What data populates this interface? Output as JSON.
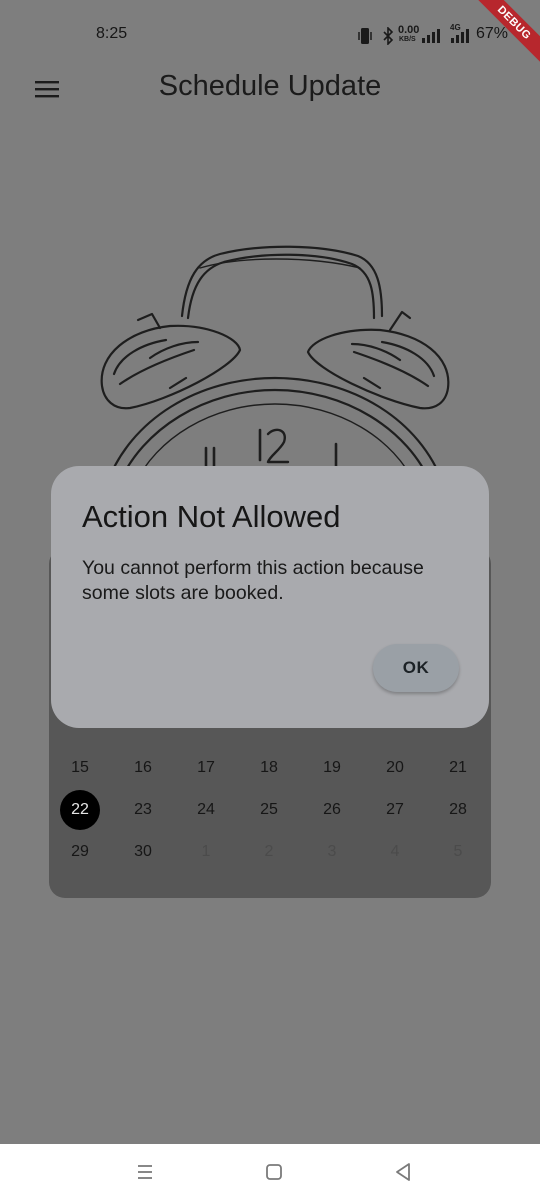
{
  "status_bar": {
    "time": "8:25",
    "net_speed": "0.00",
    "net_unit": "KB/S",
    "network_type": "4G",
    "battery": "67%",
    "icons": [
      "vibrate-icon",
      "bluetooth-icon",
      "signal-icon",
      "signal-icon"
    ],
    "debug_banner": "DEBUG"
  },
  "app_bar": {
    "menu_icon": "hamburger-menu-icon",
    "title": "Schedule Update"
  },
  "illustration": {
    "icon": "alarm-clock-icon",
    "numerals": [
      "11",
      "12",
      "1"
    ]
  },
  "calendar": {
    "rows": [
      [
        {
          "d": "15"
        },
        {
          "d": "16"
        },
        {
          "d": "17"
        },
        {
          "d": "18"
        },
        {
          "d": "19"
        },
        {
          "d": "20"
        },
        {
          "d": "21"
        }
      ],
      [
        {
          "d": "22",
          "selected": true
        },
        {
          "d": "23"
        },
        {
          "d": "24"
        },
        {
          "d": "25"
        },
        {
          "d": "26"
        },
        {
          "d": "27"
        },
        {
          "d": "28"
        }
      ],
      [
        {
          "d": "29"
        },
        {
          "d": "30"
        },
        {
          "d": "1",
          "muted": true
        },
        {
          "d": "2",
          "muted": true
        },
        {
          "d": "3",
          "muted": true
        },
        {
          "d": "4",
          "muted": true
        },
        {
          "d": "5",
          "muted": true
        }
      ]
    ],
    "selected_date": "22"
  },
  "dialog": {
    "title": "Action Not Allowed",
    "message": "You cannot perform this action because some slots are booked.",
    "ok_label": "OK"
  },
  "nav_bar": {
    "buttons": [
      "menu-icon",
      "home-icon",
      "back-icon"
    ]
  },
  "colors": {
    "scrim": "#7e7e7e",
    "dialog_bg": "#a9aaae",
    "calendar_bg": "#575757",
    "selected_day": "#000000",
    "debug_ribbon": "#b7272d"
  }
}
